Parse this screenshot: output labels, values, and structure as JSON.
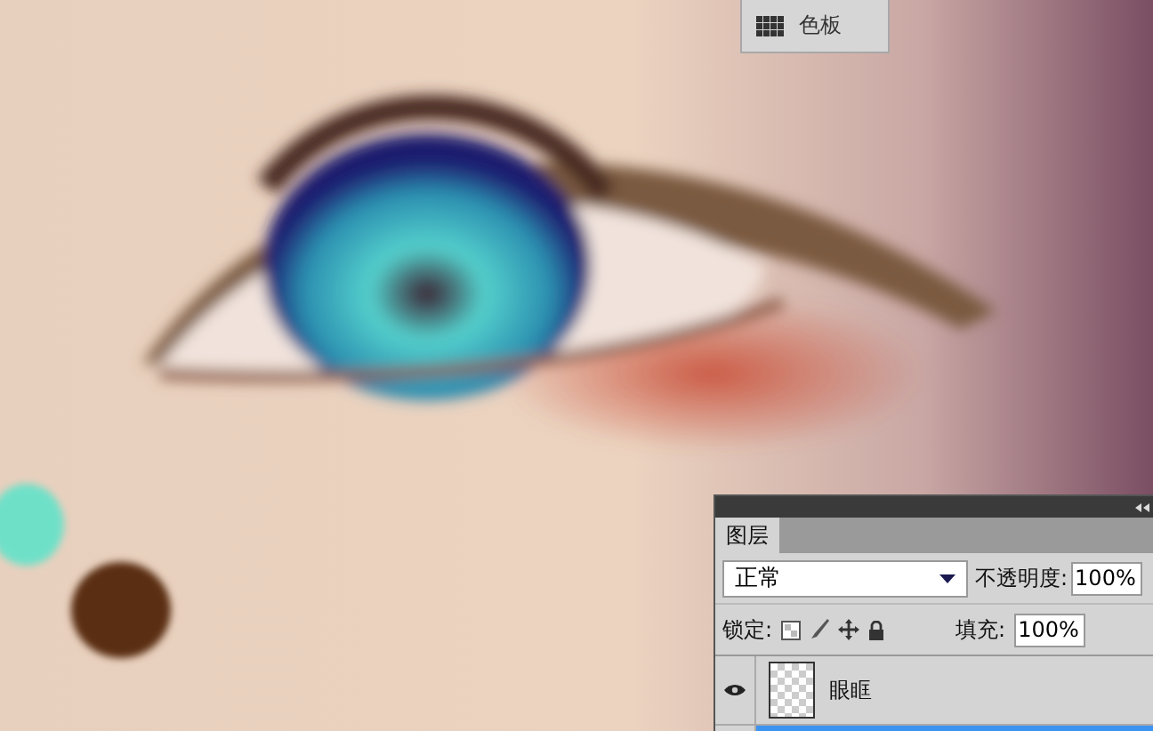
{
  "swatches_button": {
    "label": "色板"
  },
  "layers_panel": {
    "tabs": [
      {
        "label": "图层",
        "selected": true
      }
    ],
    "blend_mode": "正常",
    "opacity_label": "不透明度:",
    "opacity": "100%",
    "lock_label": "锁定:",
    "fill_label": "填充:",
    "fill": "100%",
    "layers": [
      {
        "name": "眼眶",
        "visible": true,
        "selected": false
      },
      {
        "selected": true
      }
    ]
  }
}
